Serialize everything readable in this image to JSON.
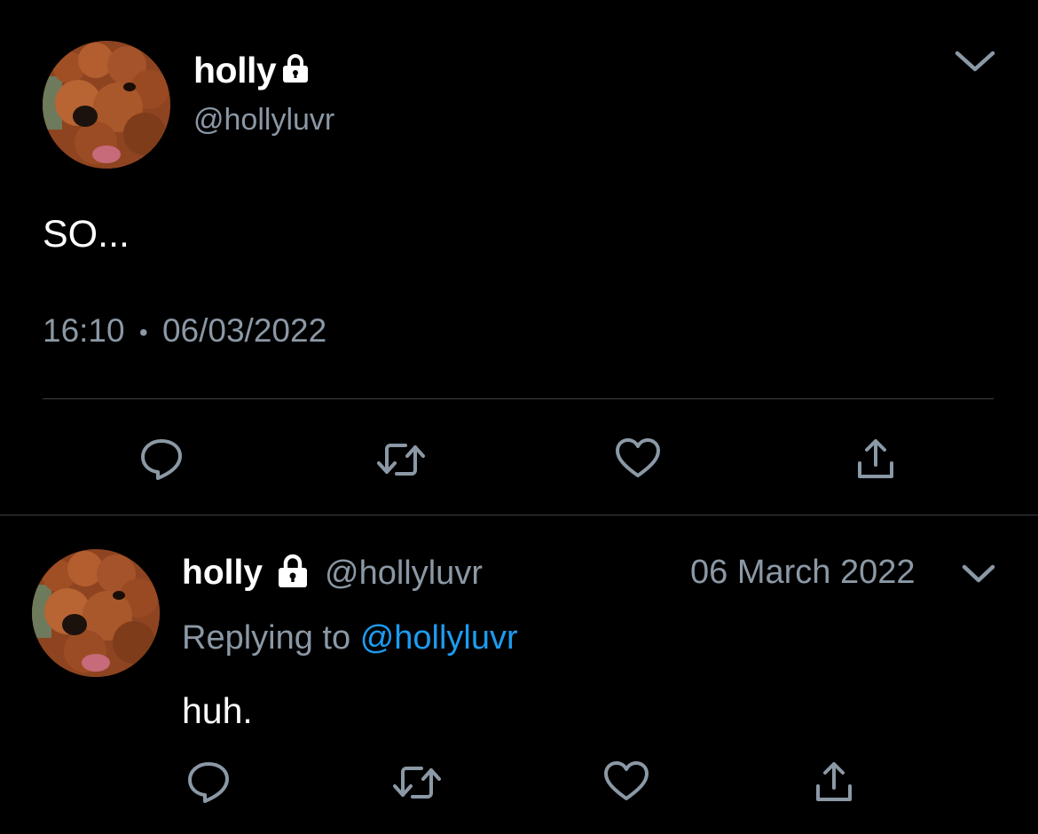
{
  "main_tweet": {
    "display_name": "holly",
    "handle": "@hollyluvr",
    "text": "SO...",
    "time": "16:10",
    "separator": "•",
    "date": "06/03/2022"
  },
  "reply_tweet": {
    "display_name": "holly",
    "handle": "@hollyluvr",
    "date": "06 March 2022",
    "replying_prefix": "Replying to",
    "replying_handle": "@hollyluvr",
    "text": "huh."
  },
  "colors": {
    "background": "#000000",
    "text": "#ffffff",
    "secondary": "#8b98a5",
    "link": "#1d9bf0",
    "divider": "#3a3f44"
  },
  "icons": {
    "reply": "reply-icon",
    "retweet": "retweet-icon",
    "like": "heart-icon",
    "share": "share-icon",
    "menu": "chevron-down-icon",
    "protected": "lock-icon"
  }
}
